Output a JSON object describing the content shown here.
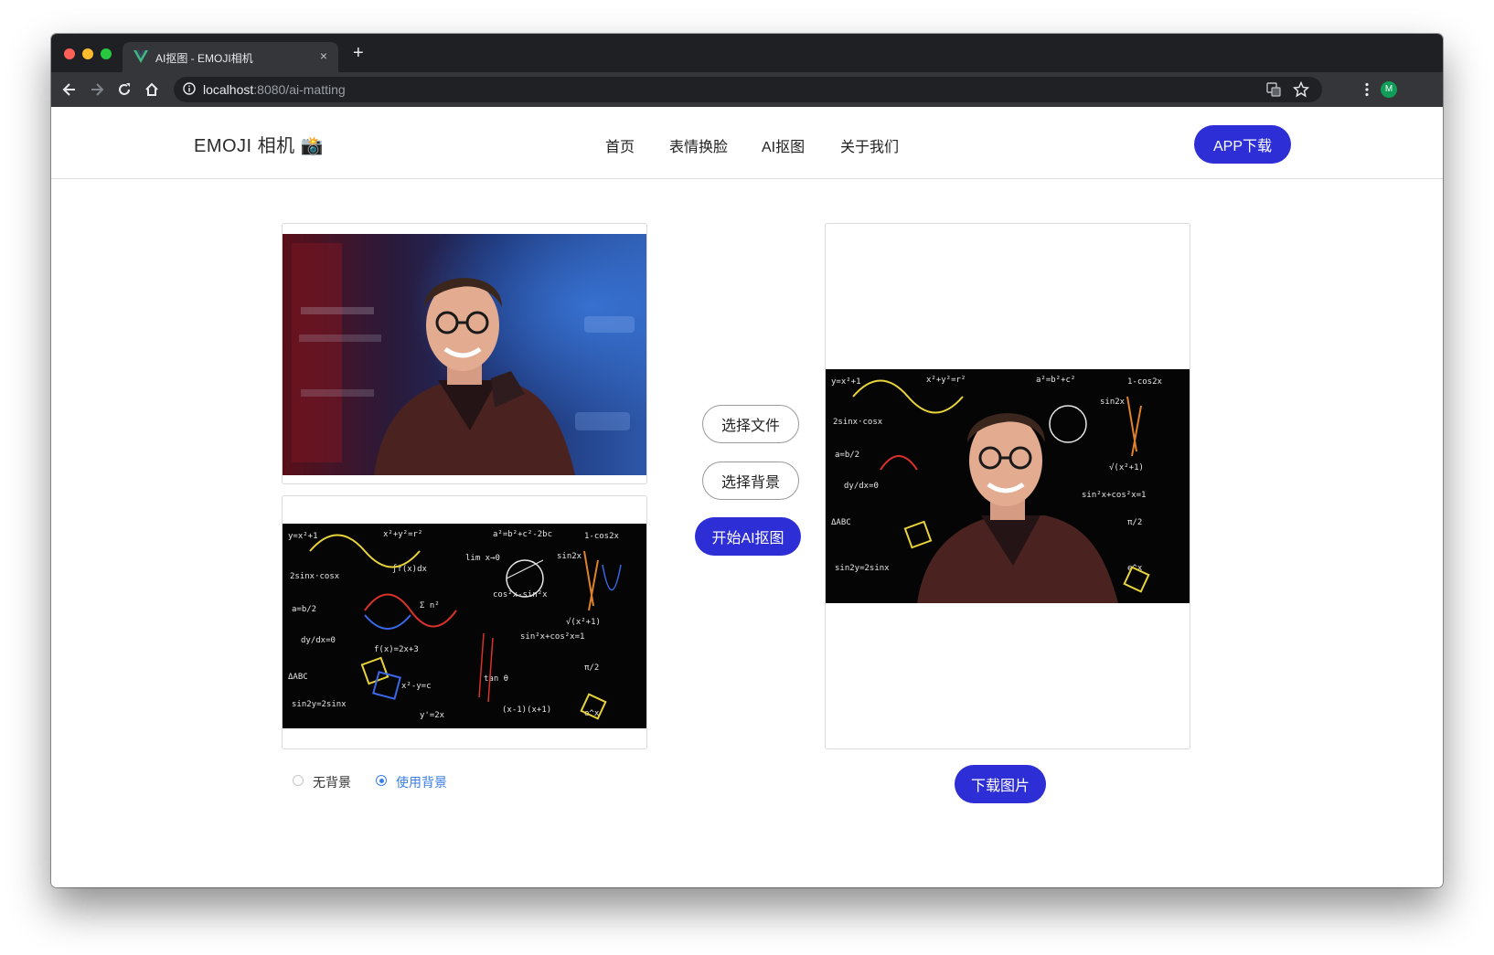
{
  "browser": {
    "tab_title": "AI抠图 - EMOJI相机",
    "tab_close": "×",
    "new_tab": "+",
    "url_host": "localhost",
    "url_rest": ":8080/ai-matting",
    "profile_initial": "M"
  },
  "header": {
    "logo": "EMOJI 相机 📸",
    "nav": [
      {
        "label": "首页"
      },
      {
        "label": "表情换脸"
      },
      {
        "label": "AI抠图"
      },
      {
        "label": "关于我们"
      }
    ],
    "app_download": "APP下载"
  },
  "controls": {
    "select_file": "选择文件",
    "select_background": "选择背景",
    "start": "开始AI抠图",
    "download": "下载图片"
  },
  "background_options": [
    {
      "label": "无背景",
      "selected": false
    },
    {
      "label": "使用背景",
      "selected": true
    }
  ],
  "colors": {
    "accent": "#2d2ed6",
    "radio_selected": "#3a7ee8"
  }
}
